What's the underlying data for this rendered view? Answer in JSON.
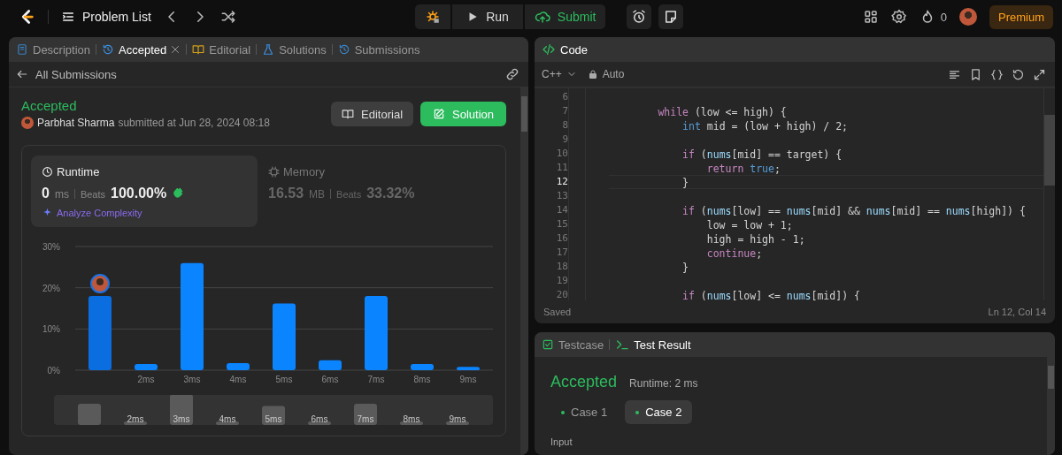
{
  "top_bar": {
    "problem_list": "Problem List",
    "run": "Run",
    "submit": "Submit",
    "streak": "0",
    "premium": "Premium"
  },
  "left_panel": {
    "tabs": [
      {
        "label": "Description",
        "selected": false,
        "closable": false
      },
      {
        "label": "Accepted",
        "selected": true,
        "closable": true
      },
      {
        "label": "Editorial",
        "selected": false,
        "closable": false
      },
      {
        "label": "Solutions",
        "selected": false,
        "closable": false
      },
      {
        "label": "Submissions",
        "selected": false,
        "closable": false
      }
    ],
    "back_link": "All Submissions",
    "status": "Accepted",
    "author": "Parbhat Sharma",
    "submitted": "submitted at Jun 28, 2024 08:18",
    "buttons": [
      {
        "label": "Editorial",
        "kind": "secondary"
      },
      {
        "label": "Solution",
        "kind": "primary"
      }
    ],
    "stats": [
      {
        "title": "Runtime",
        "value": "0",
        "unit": "ms",
        "beats_label": "Beats",
        "beats": "100.00%",
        "selected": true,
        "link": "Analyze Complexity"
      },
      {
        "title": "Memory",
        "value": "16.53",
        "unit": "MB",
        "beats_label": "Beats",
        "beats": "33.32%",
        "selected": false
      }
    ],
    "chart_data": {
      "type": "bar",
      "categories": [
        null,
        "2ms",
        "3ms",
        "4ms",
        "5ms",
        "6ms",
        "7ms",
        "8ms",
        "9ms"
      ],
      "values": [
        18,
        1.5,
        26,
        1.7,
        16.2,
        2.4,
        18,
        1.5,
        0.8
      ],
      "ylim": [
        0,
        30
      ],
      "yticks": [
        {
          "value": 0,
          "label": "0%"
        },
        {
          "value": 10,
          "label": "10%"
        },
        {
          "value": 20,
          "label": "20%"
        },
        {
          "value": 30,
          "label": "30%"
        }
      ]
    },
    "overview_labels": [
      "2ms",
      "3ms",
      "4ms",
      "5ms",
      "6ms",
      "7ms",
      "8ms",
      "9ms"
    ]
  },
  "code_panel": {
    "title": "Code",
    "language": "C++",
    "mode": "Auto",
    "lines": [
      {
        "number": "6",
        "current": false
      },
      {
        "number": "7",
        "current": false,
        "tokens": [
          {
            "kind": "keyword",
            "text": "        while"
          },
          {
            "kind": "plain",
            "text": " (low <= high) {"
          }
        ]
      },
      {
        "number": "8",
        "current": false,
        "tokens": [
          {
            "kind": "type",
            "text": "            int"
          },
          {
            "kind": "plain",
            "text": " mid = (low + high) / 2;"
          }
        ]
      },
      {
        "number": "9",
        "current": false
      },
      {
        "number": "10",
        "current": false,
        "tokens": [
          {
            "kind": "keyword",
            "text": "            if"
          },
          {
            "kind": "plain",
            "text": " ("
          },
          {
            "kind": "var",
            "text": "nums"
          },
          {
            "kind": "plain",
            "text": "[mid] == target) {"
          }
        ]
      },
      {
        "number": "11",
        "current": false,
        "tokens": [
          {
            "kind": "keyword",
            "text": "                return"
          },
          {
            "kind": "type",
            "text": " true"
          },
          {
            "kind": "plain",
            "text": ";"
          }
        ]
      },
      {
        "number": "12",
        "current": true,
        "tokens": [
          {
            "kind": "plain",
            "text": "            }"
          }
        ]
      },
      {
        "number": "13",
        "current": false
      },
      {
        "number": "14",
        "current": false,
        "tokens": [
          {
            "kind": "keyword",
            "text": "            if"
          },
          {
            "kind": "plain",
            "text": " ("
          },
          {
            "kind": "var",
            "text": "nums"
          },
          {
            "kind": "plain",
            "text": "[low] == "
          },
          {
            "kind": "var",
            "text": "nums"
          },
          {
            "kind": "plain",
            "text": "[mid] && "
          },
          {
            "kind": "var",
            "text": "nums"
          },
          {
            "kind": "plain",
            "text": "[mid] == "
          },
          {
            "kind": "var",
            "text": "nums"
          },
          {
            "kind": "plain",
            "text": "[high]) {"
          }
        ]
      },
      {
        "number": "15",
        "current": false,
        "tokens": [
          {
            "kind": "plain",
            "text": "                low = low + 1;"
          }
        ]
      },
      {
        "number": "16",
        "current": false,
        "tokens": [
          {
            "kind": "plain",
            "text": "                high = high - 1;"
          }
        ]
      },
      {
        "number": "17",
        "current": false,
        "tokens": [
          {
            "kind": "keyword",
            "text": "                continue"
          },
          {
            "kind": "plain",
            "text": ";"
          }
        ]
      },
      {
        "number": "18",
        "current": false,
        "tokens": [
          {
            "kind": "plain",
            "text": "            }"
          }
        ]
      },
      {
        "number": "19",
        "current": false
      },
      {
        "number": "20",
        "current": false,
        "tokens": [
          {
            "kind": "keyword",
            "text": "            if"
          },
          {
            "kind": "plain",
            "text": " ("
          },
          {
            "kind": "var",
            "text": "nums"
          },
          {
            "kind": "plain",
            "text": "[low] <= "
          },
          {
            "kind": "var",
            "text": "nums"
          },
          {
            "kind": "plain",
            "text": "[mid]) {"
          }
        ]
      }
    ],
    "saved": "Saved",
    "cursor": "Ln 12, Col 14"
  },
  "test_panel": {
    "tabs": [
      {
        "label": "Testcase",
        "selected": false
      },
      {
        "label": "Test Result",
        "selected": true
      }
    ],
    "status": "Accepted",
    "runtime": "Runtime: 2 ms",
    "cases": [
      {
        "label": "Case 1",
        "selected": false
      },
      {
        "label": "Case 2",
        "selected": true
      }
    ],
    "input_label": "Input"
  }
}
